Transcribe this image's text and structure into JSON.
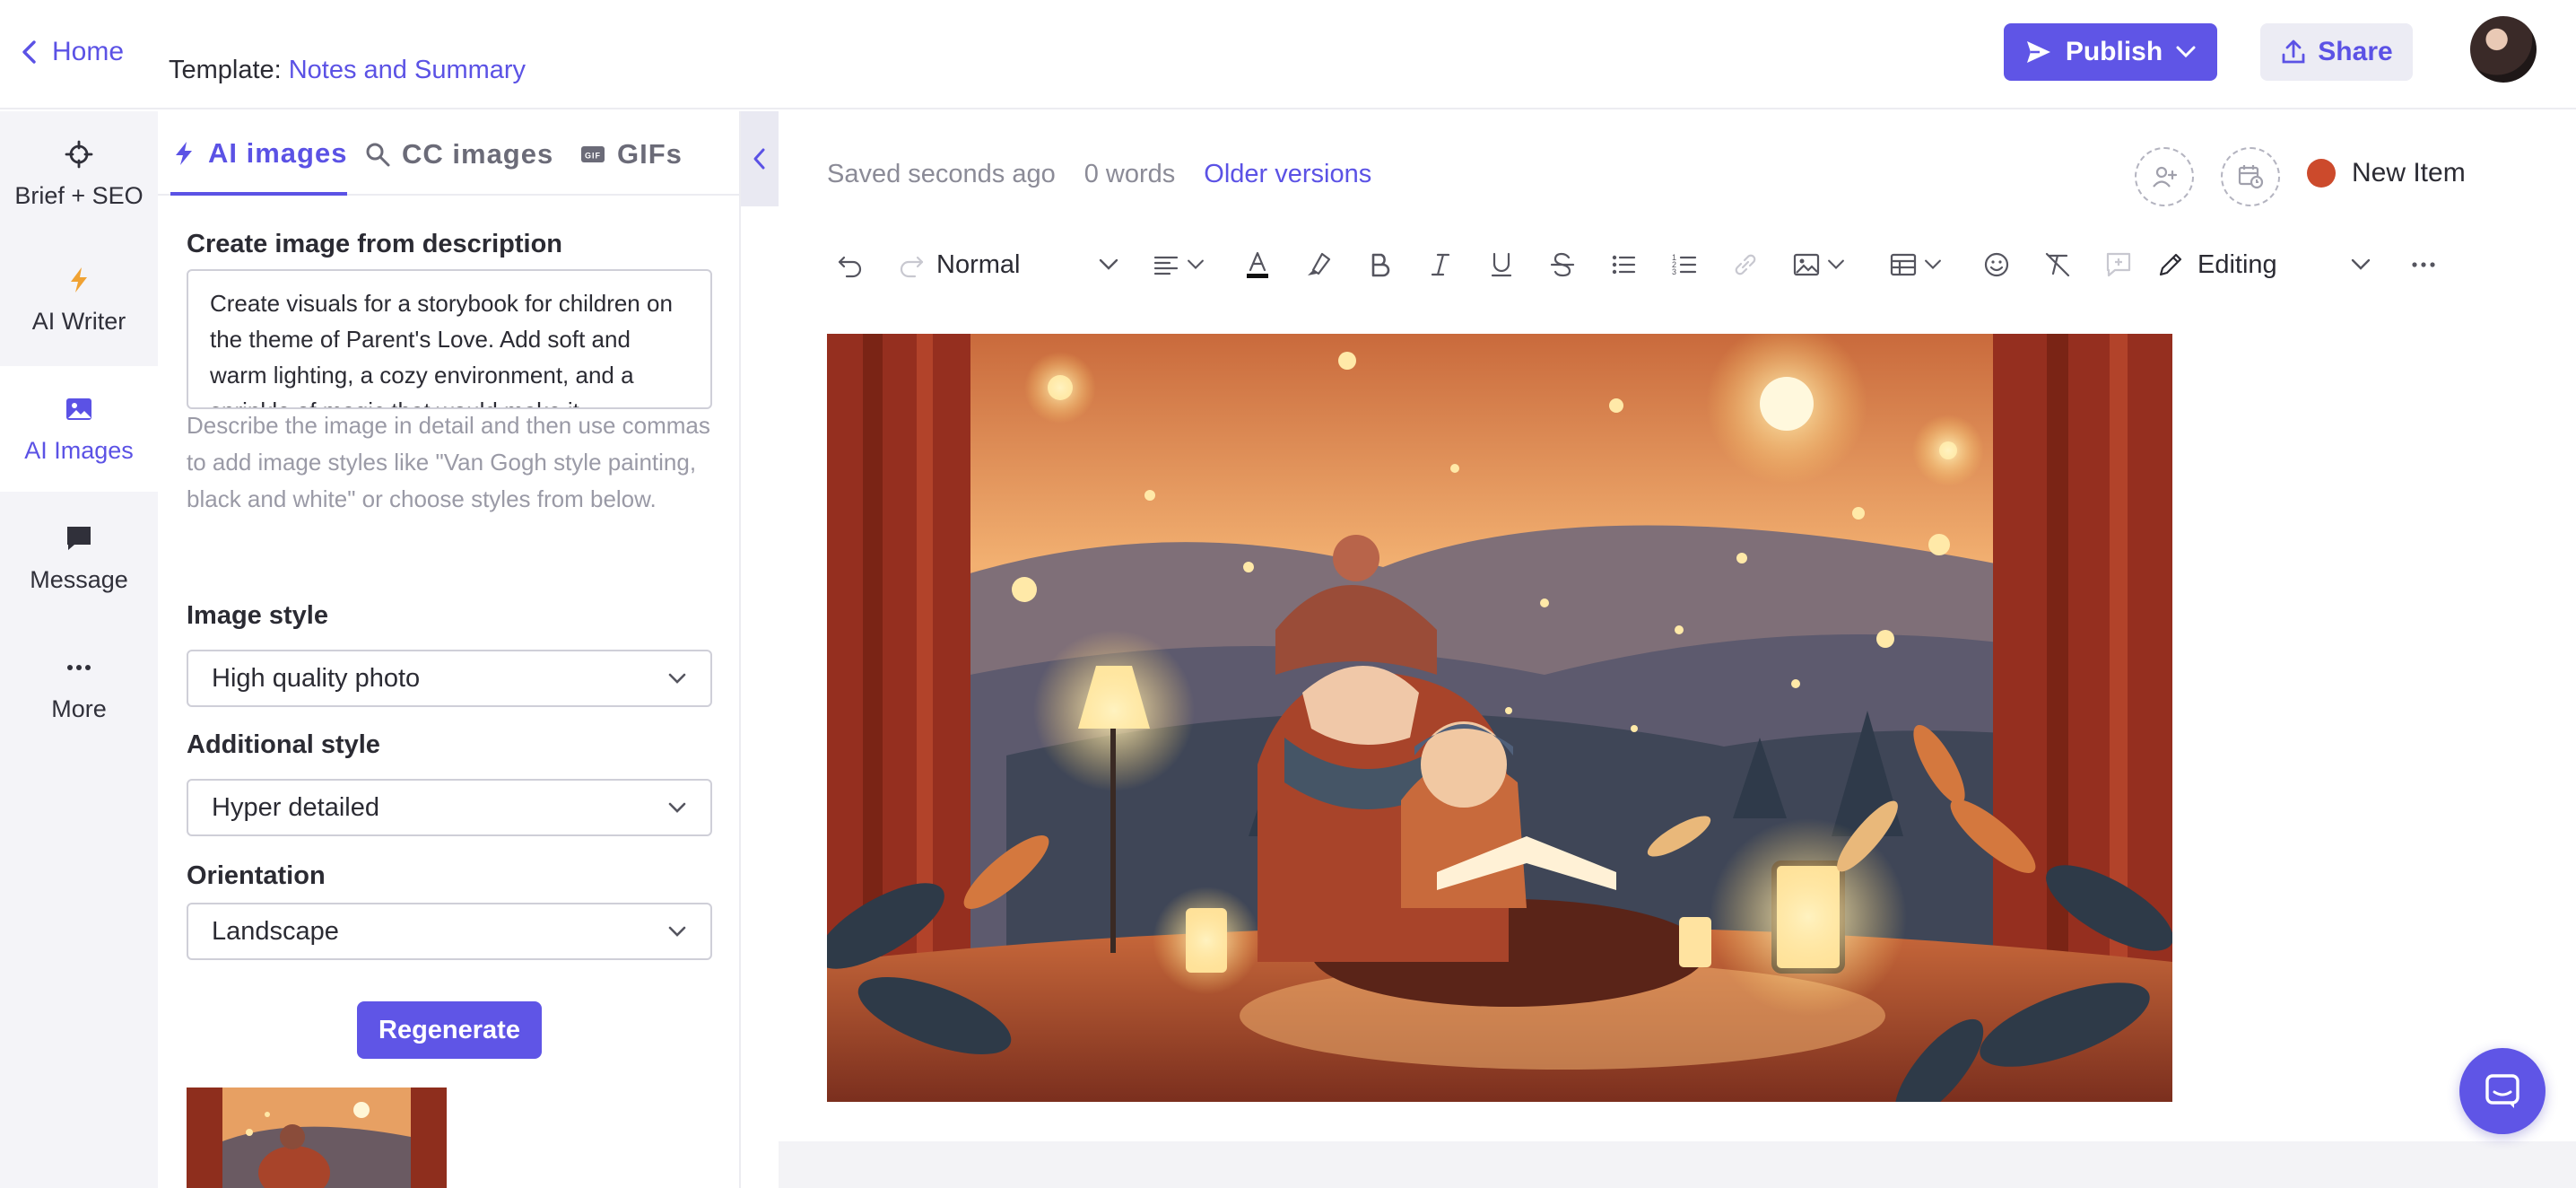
{
  "header": {
    "home_label": "Home",
    "template_prefix": "Template:",
    "template_name": "Notes and Summary",
    "publish_label": "Publish",
    "share_label": "Share"
  },
  "rail": {
    "items": [
      {
        "label": "Brief + SEO",
        "icon": "crosshair-icon"
      },
      {
        "label": "AI Writer",
        "icon": "bolt-icon"
      },
      {
        "label": "AI Images",
        "icon": "image-icon",
        "active": true
      },
      {
        "label": "Message",
        "icon": "chat-icon"
      },
      {
        "label": "More",
        "icon": "ellipsis-icon"
      }
    ]
  },
  "panel": {
    "tabs": [
      {
        "label": "AI images",
        "icon": "bolt-icon",
        "active": true
      },
      {
        "label": "CC images",
        "icon": "search-icon"
      },
      {
        "label": "GIFs",
        "icon": "gif-icon"
      }
    ],
    "description_label": "Create image from description",
    "description_value": "Create visuals for a storybook for children on the theme of Parent's Love. Add soft and warm lighting, a cozy environment, and a sprinkle of magic that would make it",
    "help_text": "Describe the image in detail and then use commas to add image styles like \"Van Gogh style painting, black and white\" or choose styles from below.",
    "image_style_label": "Image style",
    "image_style_value": "High quality photo",
    "additional_style_label": "Additional style",
    "additional_style_value": "Hyper detailed",
    "orientation_label": "Orientation",
    "orientation_value": "Landscape",
    "regenerate_label": "Regenerate"
  },
  "editor": {
    "saved_status": "Saved seconds ago",
    "word_count": "0 words",
    "older_versions_label": "Older versions",
    "new_item_label": "New Item",
    "new_item_color": "#cc4a2c",
    "toolbar": {
      "text_style": "Normal",
      "mode_label": "Editing"
    }
  },
  "colors": {
    "accent": "#5f55e6",
    "link": "#5b52e5",
    "rail_bg": "#f4f4f8"
  }
}
